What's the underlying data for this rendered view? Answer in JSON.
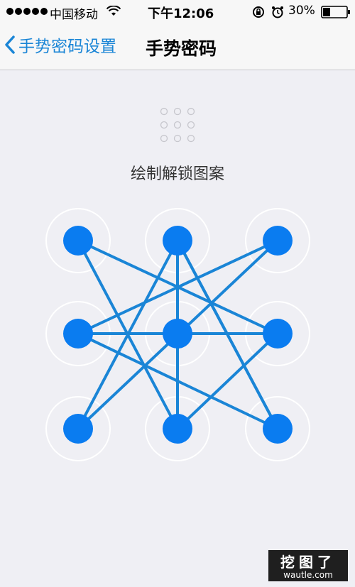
{
  "status_bar": {
    "carrier": "中国移动",
    "time": "下午12:06",
    "battery": "30%",
    "icons": [
      "signal-dots-icon",
      "wifi-icon",
      "rotation-lock-icon",
      "alarm-icon",
      "battery-icon"
    ]
  },
  "nav": {
    "back_label": "手势密码设置",
    "title": "手势密码"
  },
  "content": {
    "prompt": "绘制解锁图案"
  },
  "pattern": {
    "accent_color": "#1a85d6",
    "node_color": "#0a7cf0",
    "ring_color": "#ffffff",
    "selected_nodes": [
      1,
      2,
      3,
      4,
      5,
      6,
      7,
      8,
      9
    ],
    "connections": [
      [
        1,
        6
      ],
      [
        6,
        4
      ],
      [
        4,
        9
      ],
      [
        9,
        2
      ],
      [
        2,
        7
      ],
      [
        7,
        3
      ],
      [
        3,
        4
      ],
      [
        4,
        5
      ],
      [
        5,
        6
      ],
      [
        6,
        8
      ],
      [
        8,
        2
      ],
      [
        2,
        9
      ],
      [
        1,
        8
      ]
    ]
  },
  "watermark": {
    "title": "挖图了",
    "url": "wautle.com"
  }
}
